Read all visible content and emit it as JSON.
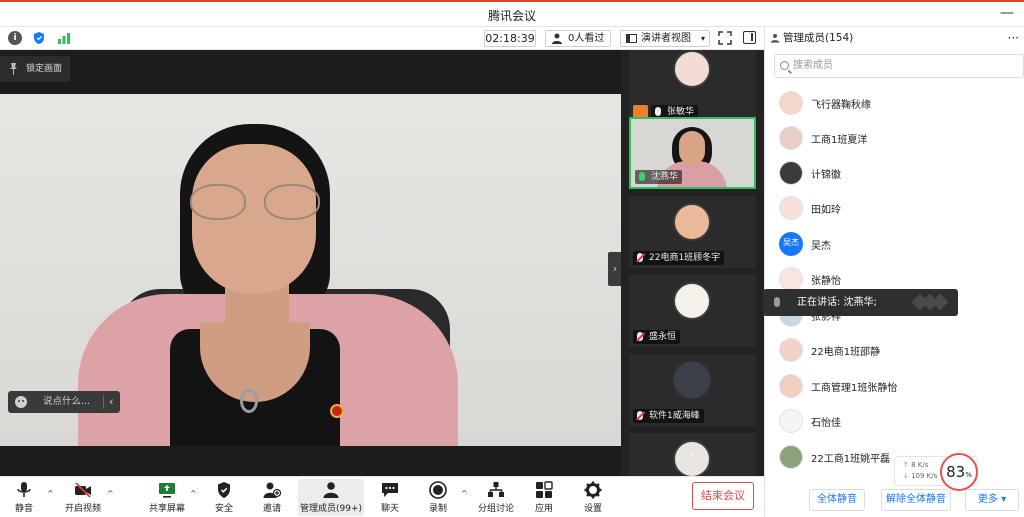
{
  "app": {
    "title": "腾讯会议",
    "minimize": "—"
  },
  "infobar": {
    "timer": "02:18:39",
    "viewers": "0人看过",
    "view_mode": "演讲者视图",
    "view_mode_caret": "▾"
  },
  "stage": {
    "lock_label": "锁定画面",
    "chat_placeholder": "说点什么...",
    "chat_chevron": "‹",
    "strip_handle": "›"
  },
  "strip": {
    "tiles": [
      {
        "name": "张敏华",
        "role": "host",
        "mic": "on"
      },
      {
        "name": "沈燕华",
        "role": "speaker",
        "mic": "on",
        "active": true
      },
      {
        "name": "22电商1班顾冬宇",
        "mic": "off"
      },
      {
        "name": "盛永恒",
        "mic": "off"
      },
      {
        "name": "软件1威海峰",
        "mic": "off"
      }
    ],
    "scroll_down": "⌄"
  },
  "panel": {
    "title": "管理成员(154)",
    "more": "···",
    "search_placeholder": "搜索成员",
    "members": [
      {
        "name": "飞行器鞠秋缘"
      },
      {
        "name": "工商1班夏洋"
      },
      {
        "name": "计锦徽"
      },
      {
        "name": "田如玲"
      },
      {
        "name": "吴杰",
        "avatar_text": "吴杰"
      },
      {
        "name": "张静怡"
      },
      {
        "name": "张影祥"
      },
      {
        "name": "22电商1班邵静"
      },
      {
        "name": "工商管理1班张静怡"
      },
      {
        "name": "石怡佳"
      },
      {
        "name": "22工商1班姚平磊"
      }
    ],
    "speaking_tooltip": "正在讲话: 沈燕华;",
    "footer": {
      "mute_all": "全体静音",
      "unmute_all": "解除全体静音",
      "more": "更多 ▾"
    },
    "network": {
      "up": "8   K/s",
      "down": "109 K/s"
    },
    "cpu": {
      "value": "83",
      "unit": "%"
    }
  },
  "toolbar": {
    "mute": "静音",
    "video": "开启视频",
    "share": "共享屏幕",
    "security": "安全",
    "invite": "邀请",
    "members": "管理成员(99+)",
    "chat": "聊天",
    "record": "录制",
    "breakout": "分组讨论",
    "apps": "应用",
    "settings": "设置",
    "end": "结束会议",
    "caret": "^"
  },
  "colors": {
    "accent": "#1677ff",
    "danger": "#e04a4a",
    "active_speaker": "#2fbf5b",
    "host": "#f07f2b"
  }
}
